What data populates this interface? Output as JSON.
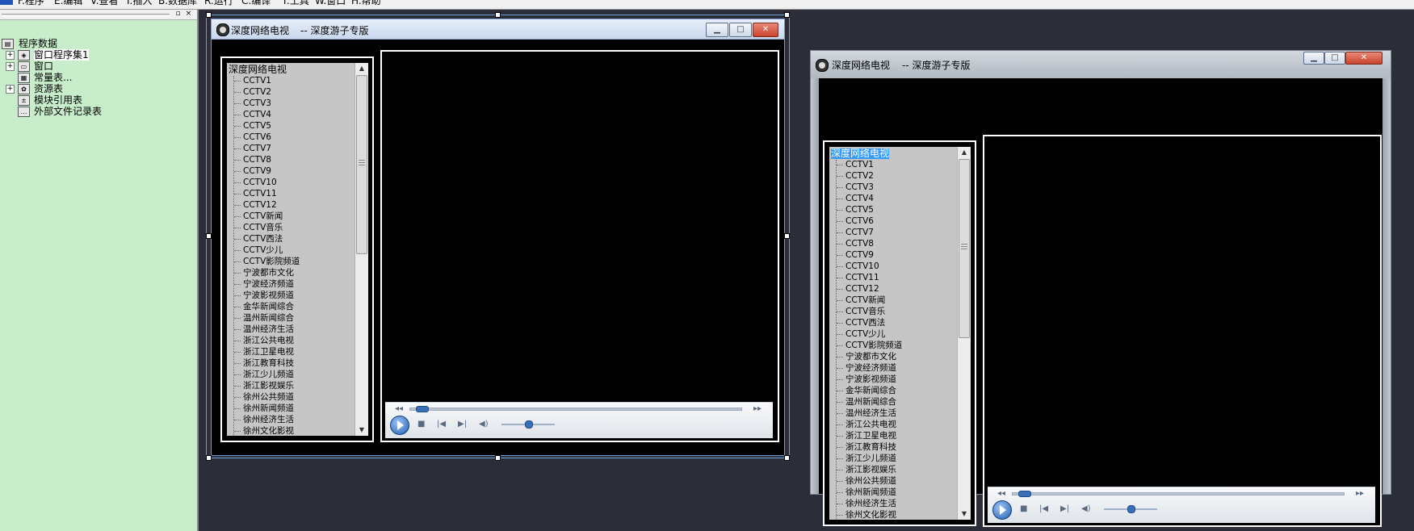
{
  "menubar": {
    "items": [
      "F.程序",
      "E.编辑",
      "V.查看",
      "I.插入",
      "B.数据库",
      "R.运行",
      "C.编译",
      "T.工具",
      "W.窗口",
      "H.帮助"
    ]
  },
  "panel": {
    "pin_glyph": "▫",
    "close_glyph": "×",
    "tree": [
      {
        "label": "程序数据",
        "icon": "program-data-icon",
        "expander": ""
      },
      {
        "label": "窗口程序集1",
        "icon": "assembly-icon",
        "expander": "+"
      },
      {
        "label": "窗口",
        "icon": "window-icon",
        "expander": "+"
      },
      {
        "label": "常量表...",
        "icon": "constant-table-icon",
        "expander": ""
      },
      {
        "label": "资源表",
        "icon": "resource-table-icon",
        "expander": "+"
      },
      {
        "label": "模块引用表",
        "icon": "module-reference-icon",
        "expander": ""
      },
      {
        "label": "外部文件记录表",
        "icon": "external-file-icon",
        "expander": ""
      }
    ]
  },
  "window": {
    "title": "深度网络电视",
    "subtitle": "-- 深度游子专版",
    "btn_min": "▁",
    "btn_max": "□",
    "btn_close": "✕"
  },
  "channels": {
    "root": "深度网络电视",
    "items": [
      "CCTV1",
      "CCTV2",
      "CCTV3",
      "CCTV4",
      "CCTV5",
      "CCTV6",
      "CCTV7",
      "CCTV8",
      "CCTV9",
      "CCTV10",
      "CCTV11",
      "CCTV12",
      "CCTV新闻",
      "CCTV音乐",
      "CCTV西法",
      "CCTV少儿",
      "CCTV影院频道",
      "宁波都市文化",
      "宁波经济频道",
      "宁波影视频道",
      "金华新闻综合",
      "温州新闻综合",
      "温州经济生活",
      "浙江公共电视",
      "浙江卫星电视",
      "浙江教育科技",
      "浙江少儿频道",
      "浙江影视娱乐",
      "徐州公共频道",
      "徐州新闻频道",
      "徐州经济生活",
      "徐州文化影视"
    ]
  },
  "player": {
    "seek_fraction": 0.02,
    "volume_fraction": 0.5,
    "rew_glyph": "◂◂",
    "ffw_glyph": "▸▸",
    "stop_glyph": "■",
    "prev_glyph": "|◀",
    "next_glyph": "▶|",
    "vol_glyph": "◀)"
  },
  "colors": {
    "panel_bg": "#c8edca",
    "workspace_bg": "#2b2e38",
    "selection": "#3399ff"
  }
}
